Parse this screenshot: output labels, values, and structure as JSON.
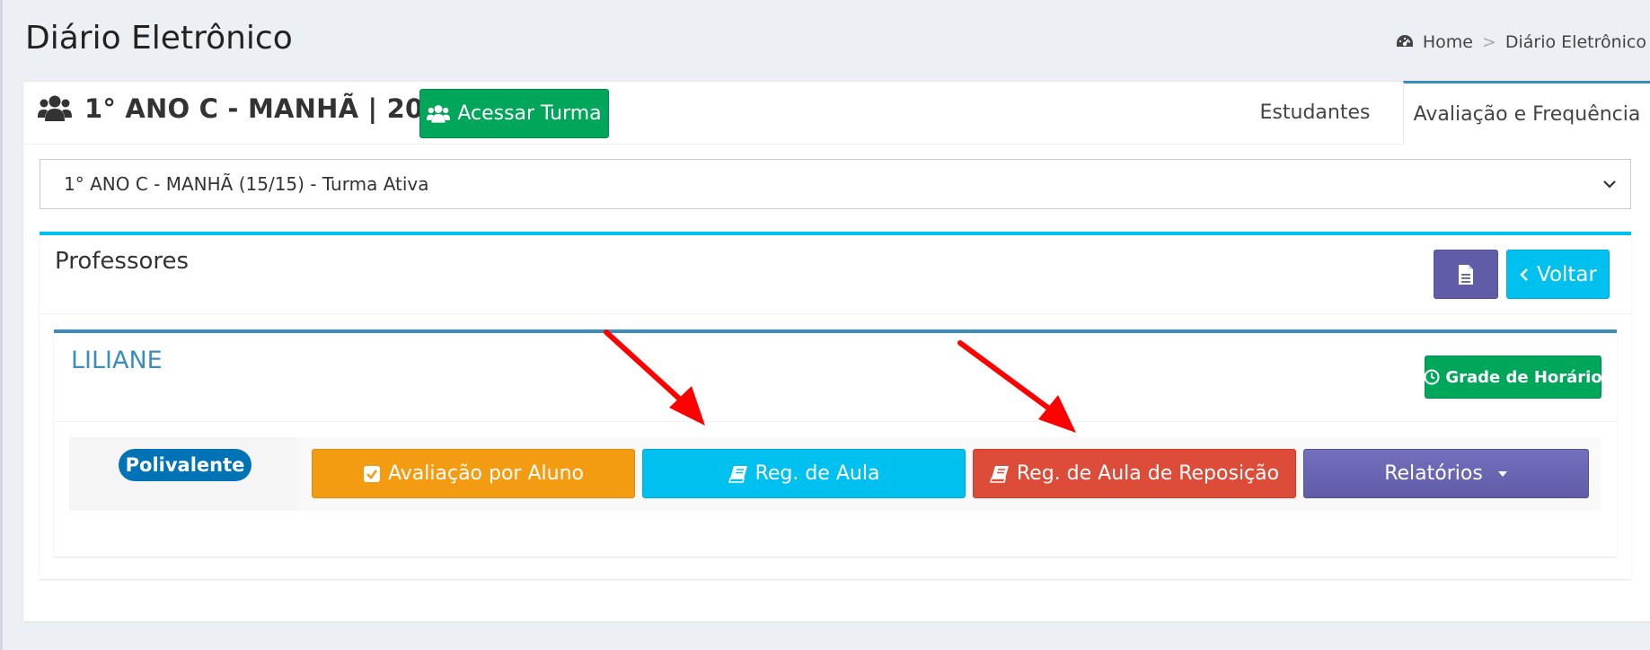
{
  "page": {
    "title": "Diário Eletrônico"
  },
  "breadcrumb": {
    "home": "Home",
    "separator": ">",
    "current": "Diário Eletrônico"
  },
  "turma": {
    "title": "1° ANO C - MANHÃ | 2025",
    "access_button": "Acessar Turma"
  },
  "tabs": [
    {
      "label": "Estudantes",
      "active": false
    },
    {
      "label": "Avaliação e Frequência",
      "active": true
    }
  ],
  "turma_select": {
    "selected": "1° ANO C - MANHÃ (15/15) - Turma Ativa"
  },
  "professores": {
    "title": "Professores",
    "back_button": "Voltar"
  },
  "teacher": {
    "name": "LILIANE",
    "grade_button": "Grade de Horário",
    "badge": "Polivalente",
    "actions": {
      "avaliacao": "Avaliação por Aluno",
      "reg_aula": "Reg. de Aula",
      "reg_reposicao": "Reg. de Aula de Reposição",
      "relatorios": "Relatórios"
    }
  },
  "colors": {
    "green": "#00a65a",
    "aqua": "#00c0ef",
    "orange": "#f39c12",
    "red": "#dd4b39",
    "purple": "#605ca8",
    "blue": "#3c8dbc",
    "annotation_arrow": "#ff0000"
  },
  "icons": {
    "breadcrumb": "dashboard-icon",
    "turma": "users-icon",
    "access": "users-icon",
    "document": "file-text-icon",
    "back": "chevron-left-icon",
    "grade": "clock-icon",
    "avaliacao": "check-square-icon",
    "reg_aula": "book-icon",
    "reg_reposicao": "book-icon",
    "relatorios": "caret-down-icon",
    "select": "chevron-down-icon"
  }
}
